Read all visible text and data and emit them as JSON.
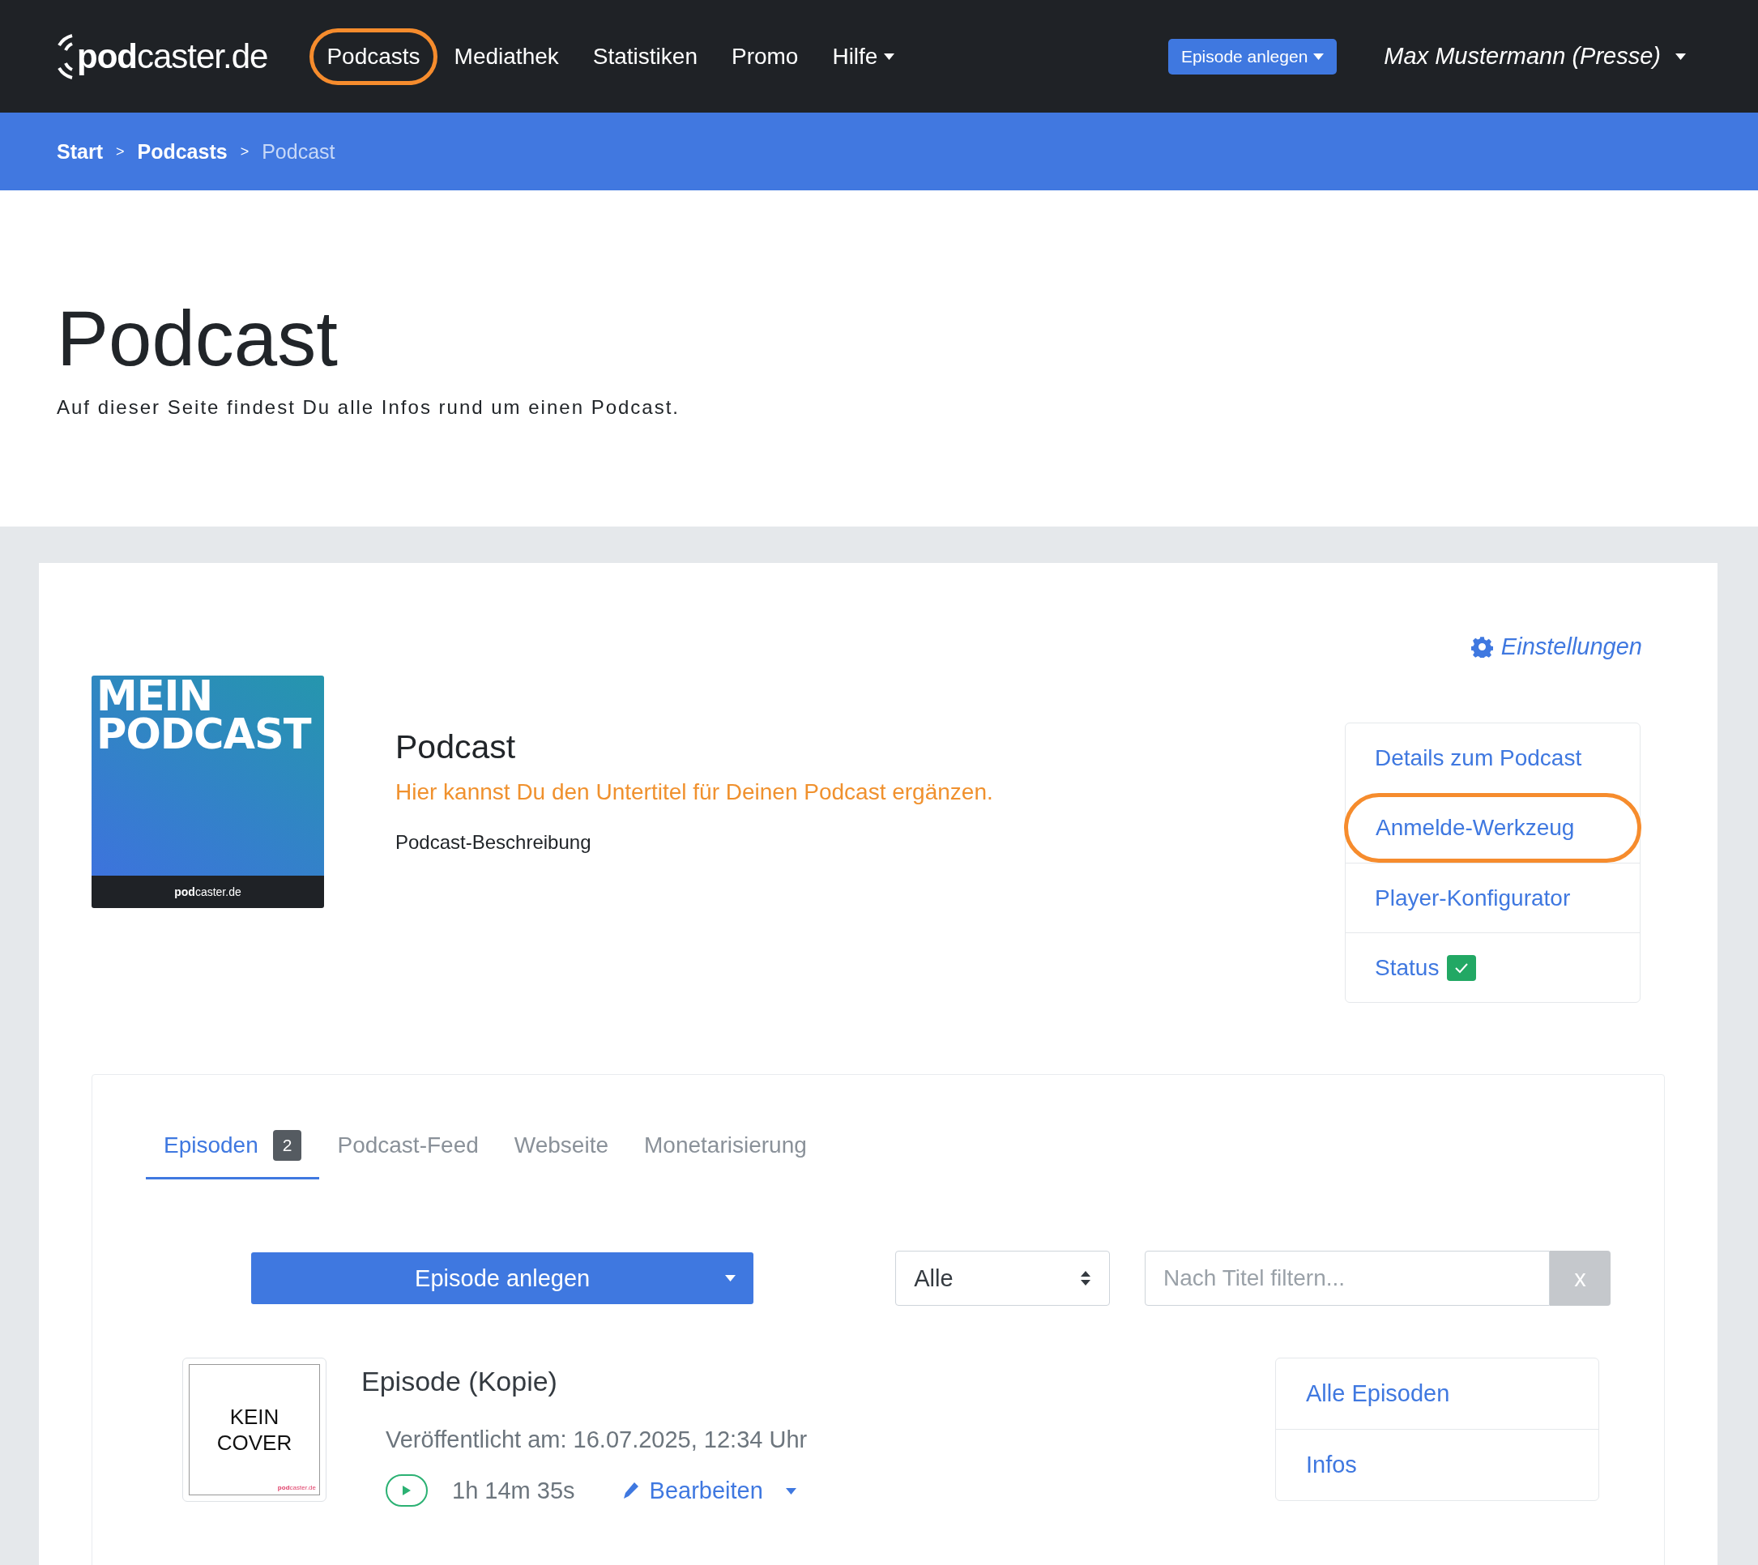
{
  "navbar": {
    "logo": "**pod**caster.de",
    "items": [
      {
        "label": "Podcasts",
        "highlighted": true,
        "dropdown": false
      },
      {
        "label": "Mediathek",
        "highlighted": false,
        "dropdown": false
      },
      {
        "label": "Statistiken",
        "highlighted": false,
        "dropdown": false
      },
      {
        "label": "Promo",
        "highlighted": false,
        "dropdown": false
      },
      {
        "label": "Hilfe",
        "highlighted": false,
        "dropdown": true
      }
    ],
    "create_button": "Episode anlegen",
    "user": "Max Mustermann (Presse)"
  },
  "breadcrumb": [
    {
      "label": "Start",
      "current": false,
      "separator": ">"
    },
    {
      "label": "Podcasts",
      "current": false,
      "separator": ">"
    },
    {
      "label": "Podcast",
      "current": true
    }
  ],
  "header": {
    "title": "Podcast",
    "lead": "Auf dieser Seite findest Du alle Infos rund um einen Podcast."
  },
  "podcast": {
    "settings_link": "Einstellungen",
    "cover": {
      "lines": [
        "MEIN",
        "PODCAST"
      ],
      "brand": "**pod**caster.de"
    },
    "title": "Podcast",
    "subtitle": "Hier kannst Du den Untertitel für Deinen Podcast ergänzen.",
    "description": "Podcast-Beschreibung",
    "menu": [
      {
        "label": "Details zum Podcast",
        "highlighted": false,
        "status_ok": false
      },
      {
        "label": "Anmelde-Werkzeug",
        "highlighted": true,
        "status_ok": false
      },
      {
        "label": "Player-Konfigurator",
        "highlighted": false,
        "status_ok": false
      },
      {
        "label": "Status",
        "highlighted": false,
        "status_ok": true
      }
    ]
  },
  "tabs": [
    {
      "label": "Episoden",
      "selected": true,
      "count": "2"
    },
    {
      "label": "Podcast-Feed",
      "selected": false
    },
    {
      "label": "Webseite",
      "selected": false
    },
    {
      "label": "Monetarisierung",
      "selected": false
    }
  ],
  "toolbar": {
    "create_button": "Episode anlegen",
    "filter_select": "Alle",
    "search": {
      "placeholder": "Nach Titel filtern..."
    },
    "clear_button": "x"
  },
  "episodes": [
    {
      "cover": {
        "lines": [
          "KEIN",
          "COVER"
        ],
        "brand": "**pod**caster.de"
      },
      "title": "Episode (Kopie)",
      "published": "Veröffentlicht am: 16.07.2025, 12:34 Uhr",
      "duration": "1h 14m 35s",
      "edit": "Bearbeiten",
      "menu": [
        "Alle Episoden",
        "Infos"
      ]
    }
  ]
}
